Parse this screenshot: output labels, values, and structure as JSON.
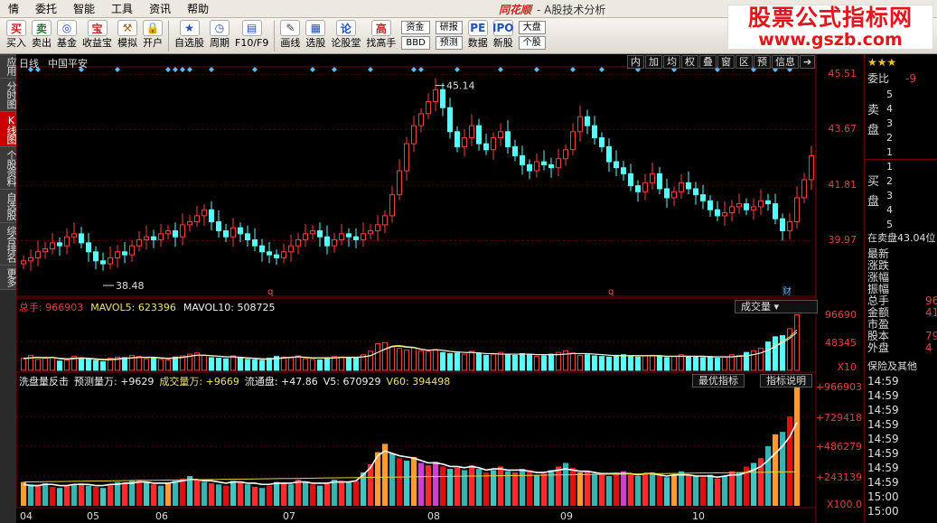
{
  "app": {
    "brand": "同花顺",
    "title": "- A股技术分析"
  },
  "menu": [
    "情",
    "委托",
    "智能",
    "工具",
    "资讯",
    "帮助"
  ],
  "toolbar": {
    "buttons": [
      {
        "name": "buy",
        "icon": "买",
        "label": "买入",
        "color": "#d02020"
      },
      {
        "name": "sell",
        "icon": "卖",
        "label": "卖出",
        "color": "#208020"
      },
      {
        "name": "fund",
        "icon": "◎",
        "label": "基金",
        "color": "#2050c0"
      },
      {
        "name": "profit-treasure",
        "icon": "宝",
        "label": "收益宝",
        "color": "#d02020"
      },
      {
        "name": "simulate",
        "icon": "⚒",
        "label": "模拟",
        "color": "#b06010"
      },
      {
        "name": "open-account",
        "icon": "🔒",
        "label": "开户",
        "color": "#806000"
      },
      {
        "name": "watchlist",
        "icon": "★",
        "label": "自选股",
        "color": "#2050c0"
      },
      {
        "name": "period",
        "icon": "◷",
        "label": "周期",
        "color": "#2050c0"
      },
      {
        "name": "f10",
        "icon": "▤",
        "label": "F10/F9",
        "color": "#2050c0"
      },
      {
        "name": "draw-line",
        "icon": "✎",
        "label": "画线",
        "color": "#404040"
      },
      {
        "name": "stock-picker",
        "icon": "▦",
        "label": "选股",
        "color": "#2050c0"
      },
      {
        "name": "forum",
        "icon": "论",
        "label": "论股堂",
        "color": "#2050c0"
      },
      {
        "name": "find-master",
        "icon": "高",
        "label": "找高手",
        "color": "#d02020"
      }
    ],
    "stack1": [
      "资金",
      "BBD"
    ],
    "stack2": [
      "研报",
      "预测"
    ],
    "data_btn": {
      "icon": "PE",
      "label": "数据"
    },
    "new_stock_btn": {
      "icon": "IPO",
      "label": "新股"
    },
    "stack3": [
      "大盘",
      "个股"
    ]
  },
  "watermark": {
    "line1": "股票公式指标网",
    "line2": "www.gszb.com"
  },
  "sidetabs": [
    {
      "label": "应用",
      "active": false
    },
    {
      "label": "分时图",
      "active": false
    },
    {
      "label": "K线图",
      "active": true
    },
    {
      "label": "个股资料",
      "active": false
    },
    {
      "label": "自选股",
      "active": false
    },
    {
      "label": "综合排名",
      "active": false
    },
    {
      "label": "更多",
      "active": false
    }
  ],
  "kchart": {
    "period": "日线",
    "stock": "中国平安",
    "buttons": [
      "内",
      "加",
      "均",
      "权",
      "叠",
      "窗",
      "区",
      "预",
      "信息"
    ],
    "price_labels": [
      "45.51",
      "43.67",
      "41.81",
      "39.97"
    ],
    "high_note": "45.14",
    "low_note": "38.48",
    "markers": [
      "q",
      "q",
      "财"
    ]
  },
  "volume_panel": {
    "header": [
      {
        "text": "总手: 966903",
        "color": "#e04040"
      },
      {
        "text": "MAVOL5: 623396",
        "color": "#f0e070"
      },
      {
        "text": "MAVOL10: 508725",
        "color": "#f0f0f0"
      }
    ],
    "selector": "成交量",
    "labels": [
      "96690",
      "48345",
      "X10"
    ]
  },
  "indicator_panel": {
    "header": [
      {
        "text": "洗盘量反击",
        "color": "#f0f0f0"
      },
      {
        "text": "预测量万: +9629",
        "color": "#f0f0f0"
      },
      {
        "text": "成交量万: +9669",
        "color": "#f0e070"
      },
      {
        "text": "流通盘: +47.86",
        "color": "#f0f0f0"
      },
      {
        "text": "V5: 670929",
        "color": "#f0f0f0"
      },
      {
        "text": "V60: 394498",
        "color": "#f0e070"
      }
    ],
    "btn_best": "最优指标",
    "btn_help": "指标说明",
    "labels": [
      "+966903",
      "+729418",
      "+486279",
      "+243139",
      "X100.0"
    ]
  },
  "dates": [
    "04",
    "05",
    "06",
    "07",
    "08",
    "09",
    "10"
  ],
  "info": {
    "stars": "★★★",
    "wb_label": "委比",
    "wb_value": "-9",
    "sell_label": [
      "卖",
      "盘"
    ],
    "buy_label": [
      "买",
      "盘"
    ],
    "levels_sell": [
      "5",
      "4",
      "3",
      "2",
      "1"
    ],
    "levels_buy": [
      "1",
      "2",
      "3",
      "4",
      "5"
    ],
    "status": "在卖盘43.04位",
    "fields": [
      {
        "k": "最新",
        "v": ""
      },
      {
        "k": "涨跌",
        "v": ""
      },
      {
        "k": "涨幅",
        "v": ""
      },
      {
        "k": "振幅",
        "v": ""
      },
      {
        "k": "总手",
        "v": "96"
      },
      {
        "k": "金额",
        "v": "41"
      },
      {
        "k": "市盈",
        "v": ""
      },
      {
        "k": "股本",
        "v": "79"
      },
      {
        "k": "外盘",
        "v": "4"
      }
    ],
    "insurance": "保险及其他",
    "times": [
      "14:59",
      "14:59",
      "14:59",
      "14:59",
      "14:59",
      "14:59",
      "14:59",
      "14:59",
      "15:00",
      "15:00"
    ]
  },
  "chart_data": {
    "type": "candlestick",
    "price_axis": [
      39.97,
      45.51
    ],
    "dates_ticks": [
      "04",
      "05",
      "06",
      "07",
      "08",
      "09",
      "10"
    ],
    "close_path": [
      39.3,
      39.4,
      39.6,
      39.7,
      39.9,
      39.8,
      40.1,
      40.2,
      39.9,
      39.6,
      39.3,
      39.2,
      39.4,
      39.6,
      39.5,
      39.8,
      40.0,
      40.1,
      40.0,
      40.2,
      40.3,
      40.1,
      40.5,
      40.6,
      40.8,
      41.0,
      40.6,
      40.3,
      40.1,
      40.4,
      40.2,
      40.0,
      39.8,
      39.6,
      39.5,
      39.4,
      39.6,
      39.8,
      40.0,
      40.2,
      40.3,
      40.1,
      39.8,
      40.0,
      40.2,
      40.1,
      40.0,
      40.2,
      40.3,
      40.5,
      40.8,
      41.5,
      42.3,
      43.2,
      43.8,
      44.2,
      44.6,
      45.0,
      44.4,
      43.6,
      43.1,
      43.4,
      43.8,
      43.2,
      43.0,
      43.4,
      43.6,
      43.1,
      42.8,
      42.5,
      42.3,
      42.6,
      42.5,
      42.4,
      42.7,
      43.0,
      43.6,
      44.1,
      43.8,
      43.4,
      43.1,
      42.6,
      42.4,
      42.2,
      41.8,
      41.6,
      41.9,
      42.2,
      41.7,
      41.4,
      41.6,
      41.9,
      41.7,
      41.5,
      41.3,
      41.0,
      40.8,
      40.9,
      41.1,
      41.2,
      41.0,
      41.1,
      41.3,
      41.2,
      40.7,
      40.3,
      40.6,
      41.4,
      42.0,
      42.8
    ],
    "volume": [
      21,
      26,
      19,
      23,
      22,
      16,
      18,
      24,
      20,
      19,
      17,
      15,
      21,
      23,
      22,
      26,
      24,
      20,
      21,
      19,
      18,
      23,
      25,
      28,
      30,
      26,
      22,
      21,
      20,
      25,
      22,
      19,
      18,
      17,
      21,
      24,
      23,
      22,
      25,
      20,
      19,
      18,
      22,
      24,
      23,
      21,
      22,
      27,
      33,
      46,
      48,
      41,
      38,
      35,
      39,
      34,
      33,
      36,
      31,
      29,
      30,
      28,
      33,
      30,
      26,
      28,
      31,
      27,
      26,
      29,
      28,
      24,
      25,
      28,
      31,
      34,
      30,
      26,
      27,
      25,
      24,
      23,
      26,
      27,
      24,
      23,
      25,
      26,
      24,
      22,
      24,
      27,
      24,
      23,
      22,
      24,
      21,
      23,
      27,
      26,
      31,
      34,
      38,
      49,
      58,
      60,
      72,
      96
    ],
    "v5": [
      20,
      21,
      22,
      21,
      22,
      20,
      19,
      20,
      21,
      20,
      19,
      18,
      18,
      19,
      20,
      21,
      22,
      22,
      22,
      21,
      20,
      21,
      22,
      24,
      26,
      26,
      25,
      24,
      23,
      23,
      22,
      21,
      20,
      19,
      19,
      20,
      21,
      22,
      23,
      22,
      21,
      21,
      21,
      21,
      22,
      22,
      22,
      23,
      25,
      31,
      37,
      42,
      43,
      41,
      40,
      37,
      35,
      36,
      35,
      33,
      32,
      31,
      31,
      30,
      29,
      29,
      28,
      28,
      28,
      28,
      28,
      27,
      27,
      27,
      27,
      28,
      29,
      29,
      29,
      28,
      27,
      26,
      25,
      25,
      25,
      25,
      25,
      25,
      25,
      24,
      24,
      24,
      24,
      24,
      24,
      23,
      23,
      23,
      23,
      24,
      25,
      27,
      30,
      35,
      42,
      50,
      58,
      70
    ],
    "ind_bars": [
      20,
      18,
      17,
      19,
      16,
      15,
      17,
      18,
      19,
      17,
      16,
      15,
      18,
      20,
      19,
      21,
      22,
      20,
      18,
      17,
      19,
      21,
      23,
      25,
      22,
      20,
      19,
      18,
      17,
      21,
      20,
      18,
      16,
      15,
      17,
      20,
      19,
      18,
      22,
      20,
      18,
      17,
      19,
      22,
      21,
      20,
      21,
      28,
      35,
      45,
      52,
      44,
      40,
      38,
      41,
      36,
      34,
      37,
      33,
      31,
      32,
      30,
      34,
      31,
      28,
      30,
      33,
      29,
      28,
      31,
      30,
      26,
      27,
      30,
      33,
      36,
      32,
      28,
      29,
      27,
      26,
      25,
      28,
      29,
      26,
      25,
      27,
      28,
      26,
      24,
      26,
      29,
      26,
      25,
      24,
      26,
      23,
      25,
      29,
      28,
      33,
      36,
      40,
      50,
      60,
      62,
      75,
      100
    ],
    "ind_line": [
      18,
      17,
      17,
      18,
      18,
      17,
      17,
      18,
      18,
      18,
      17,
      17,
      18,
      18,
      19,
      19,
      20,
      20,
      19,
      19,
      19,
      20,
      21,
      22,
      22,
      21,
      21,
      20,
      19,
      20,
      20,
      19,
      19,
      18,
      18,
      19,
      19,
      19,
      20,
      20,
      19,
      19,
      19,
      20,
      20,
      20,
      21,
      26,
      32,
      42,
      46,
      44,
      42,
      41,
      40,
      38,
      36,
      36,
      35,
      33,
      33,
      32,
      33,
      32,
      30,
      31,
      31,
      30,
      30,
      30,
      29,
      28,
      28,
      29,
      30,
      31,
      30,
      29,
      29,
      28,
      27,
      27,
      27,
      27,
      27,
      26,
      27,
      27,
      26,
      25,
      26,
      26,
      26,
      25,
      25,
      25,
      24,
      25,
      26,
      26,
      28,
      30,
      33,
      38,
      44,
      50,
      58,
      70
    ]
  }
}
